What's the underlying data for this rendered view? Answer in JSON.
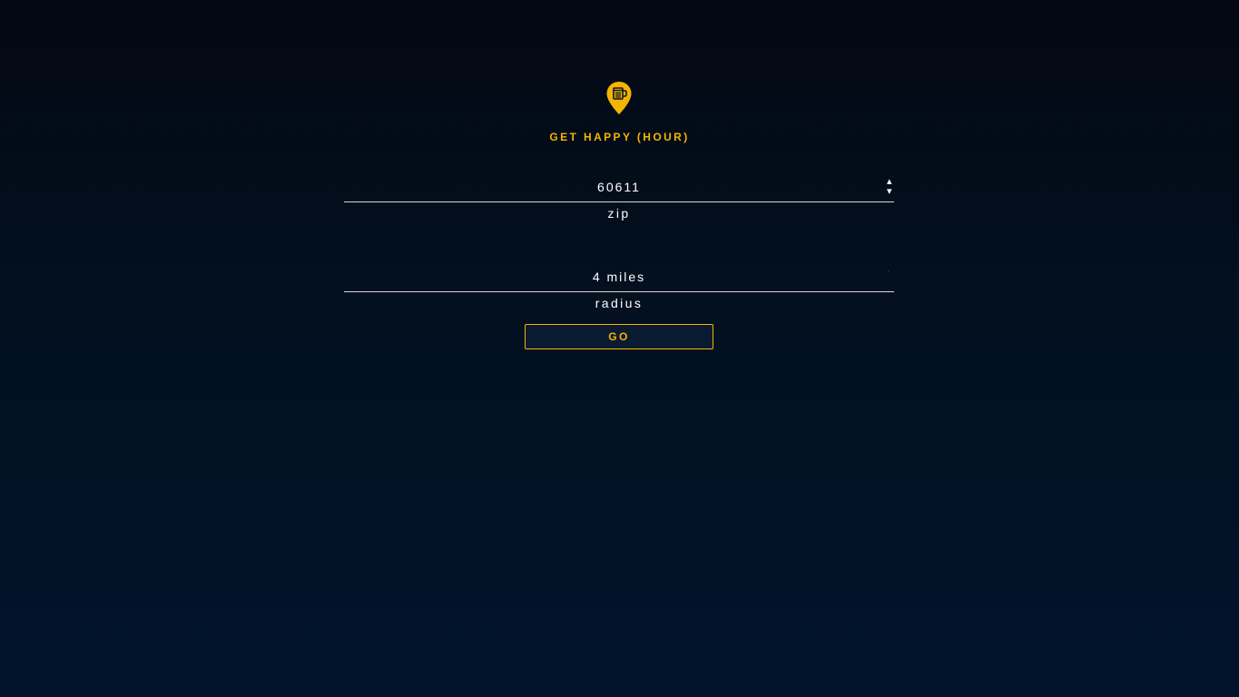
{
  "app": {
    "title": "GET HAPPY (HOUR)",
    "logo_icon": "beer-map-pin-icon",
    "accent_color": "#f5b400"
  },
  "form": {
    "zip": {
      "value": "60611",
      "label": "zip",
      "spinner_icon": "number-spinner-icon"
    },
    "radius": {
      "value": "4 miles",
      "label": "radius",
      "arrow_icon": "dropdown-arrow-icon"
    },
    "submit_label": "GO"
  }
}
